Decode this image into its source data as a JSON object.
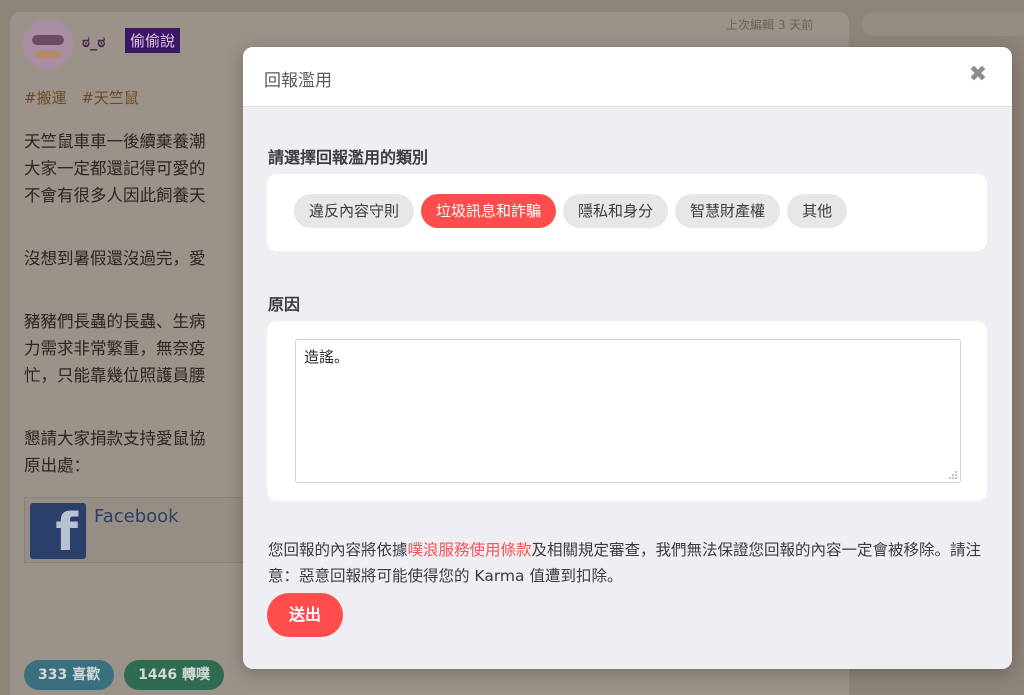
{
  "post": {
    "username": "ಠ_ಠ",
    "badge": "偷偷說",
    "edited": "上次編輯 3 天前",
    "tags": [
      "#搬運",
      "#天竺鼠"
    ],
    "lines": [
      "天竺鼠車車一後續棄養潮",
      "大家一定都還記得可愛的",
      "不會有很多人因此飼養天",
      "沒想到暑假還沒過完，愛",
      "豬豬們長蟲的長蟲、生病",
      "力需求非常繁重，無奈疫",
      "忙，只能靠幾位照護員腰",
      "懇請大家捐款支持愛鼠協",
      "原出處："
    ],
    "facebook_label": "Facebook",
    "likes": "333 喜歡",
    "reblogs": "1446 轉噗"
  },
  "modal": {
    "title": "回報濫用",
    "close_glyph": "✖",
    "category_label": "請選擇回報濫用的類別",
    "categories": [
      {
        "label": "違反內容守則",
        "selected": false
      },
      {
        "label": "垃圾訊息和詐騙",
        "selected": true
      },
      {
        "label": "隱私和身分",
        "selected": false
      },
      {
        "label": "智慧財產權",
        "selected": false
      },
      {
        "label": "其他",
        "selected": false
      }
    ],
    "reason_label": "原因",
    "reason_value": "造謠。",
    "notice_before": "您回報的內容將依據",
    "notice_link": "噗浪服務使用條款",
    "notice_after": "及相關規定審查，我們無法保證您回報的內容一定會被移除。請注意：惡意回報將可能使得您的 Karma 值遭到扣除。",
    "submit_label": "送出"
  },
  "colors": {
    "accent": "#ff4c4c",
    "link": "#f2555a",
    "badge_bg": "#3d1566"
  },
  "icons": {
    "close": "close-icon",
    "facebook": "facebook-logo-icon",
    "resize": "resize-grip-icon"
  }
}
